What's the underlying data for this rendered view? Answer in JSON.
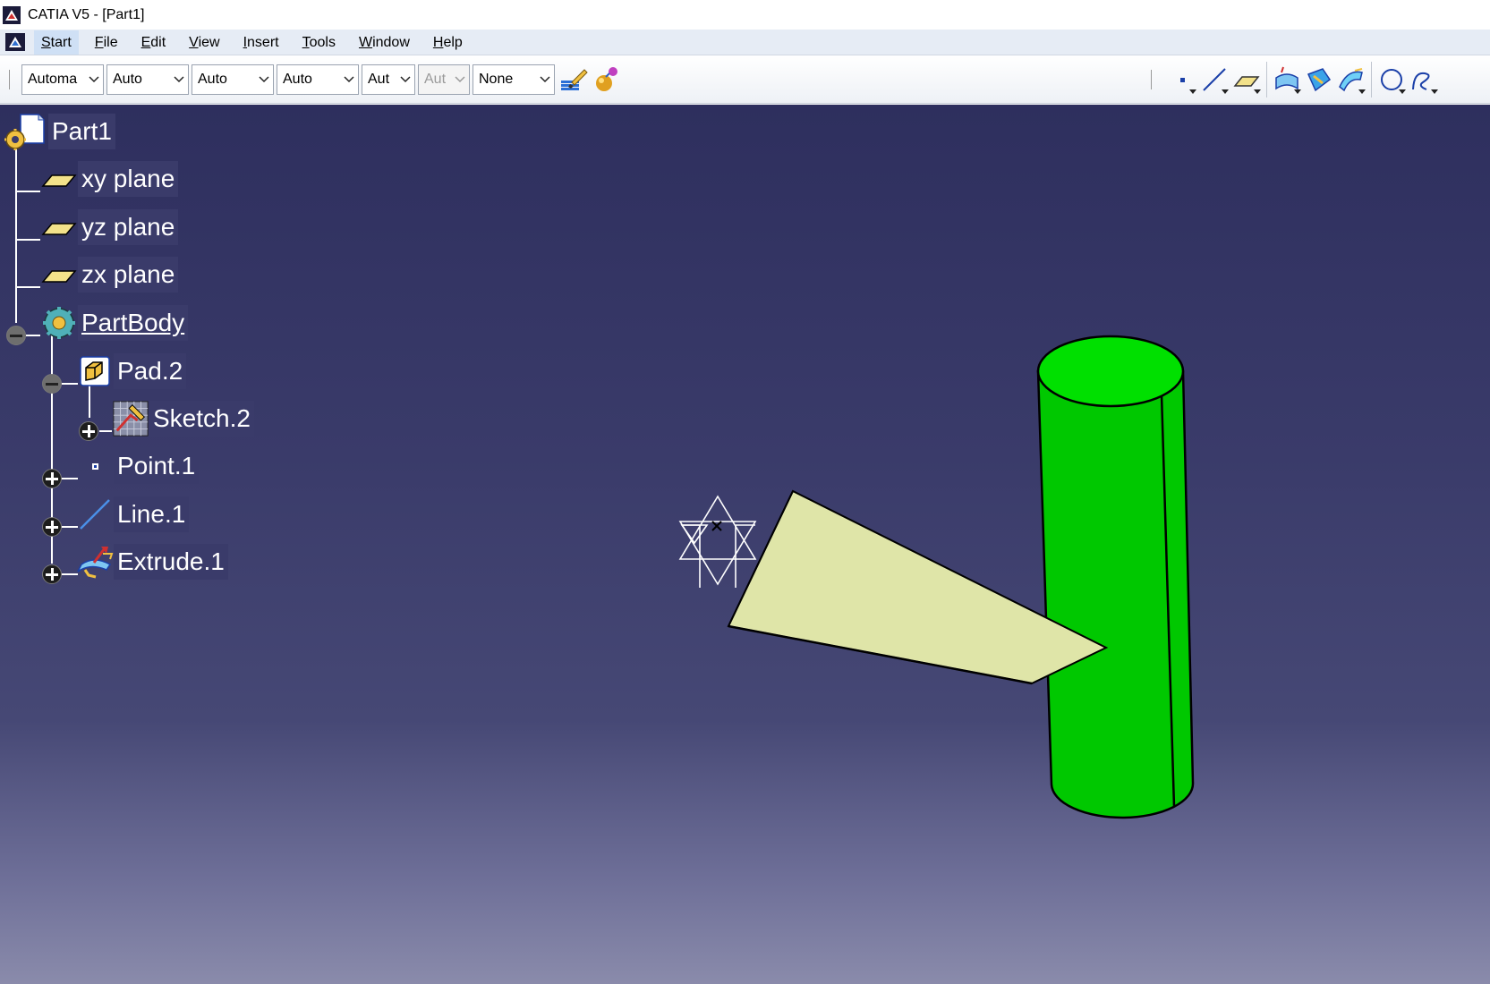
{
  "window": {
    "title": "CATIA V5 - [Part1]"
  },
  "menu": [
    {
      "label": "Start",
      "active": true
    },
    {
      "label": "File"
    },
    {
      "label": "Edit"
    },
    {
      "label": "View"
    },
    {
      "label": "Insert"
    },
    {
      "label": "Tools"
    },
    {
      "label": "Window"
    },
    {
      "label": "Help"
    }
  ],
  "toolbar": {
    "combos": [
      {
        "name": "color-combo",
        "value": "Automa"
      },
      {
        "name": "transparency-combo",
        "value": "Auto"
      },
      {
        "name": "line-thickness-combo",
        "value": "Auto"
      },
      {
        "name": "line-type-combo",
        "value": "Auto"
      },
      {
        "name": "point-type-combo",
        "value": "Aut"
      },
      {
        "name": "layer-aux-combo",
        "value": "Aut",
        "disabled": true
      },
      {
        "name": "layer-combo",
        "value": "None"
      }
    ],
    "icons_left": [
      "paintbrush-icon",
      "graphic-properties-icon"
    ],
    "icons_right": [
      "point-icon",
      "line-icon",
      "plane-icon",
      "extrude-surface-icon",
      "fill-surface-icon",
      "sweep-surface-icon",
      "circle-icon",
      "spline-icon"
    ]
  },
  "tree": {
    "root": {
      "label": "Part1",
      "icon": "part-icon"
    },
    "planes": [
      {
        "label": "xy plane",
        "icon": "plane-icon"
      },
      {
        "label": "yz plane",
        "icon": "plane-icon"
      },
      {
        "label": "zx plane",
        "icon": "plane-icon"
      }
    ],
    "body": {
      "label": "PartBody",
      "icon": "partbody-icon"
    },
    "pad": {
      "label": "Pad.2",
      "icon": "pad-icon"
    },
    "sketch": {
      "label": "Sketch.2",
      "icon": "sketch-icon"
    },
    "features": [
      {
        "label": "Point.1",
        "icon": "point-icon"
      },
      {
        "label": "Line.1",
        "icon": "line-icon"
      },
      {
        "label": "Extrude.1",
        "icon": "extrude-icon"
      }
    ]
  },
  "colors": {
    "cylinder": "#00c800",
    "cylinder_top": "#00e000",
    "surface": "#dfe5a8",
    "viewport_top": "#2e2f5e",
    "viewport_bottom": "#8a8bab"
  }
}
